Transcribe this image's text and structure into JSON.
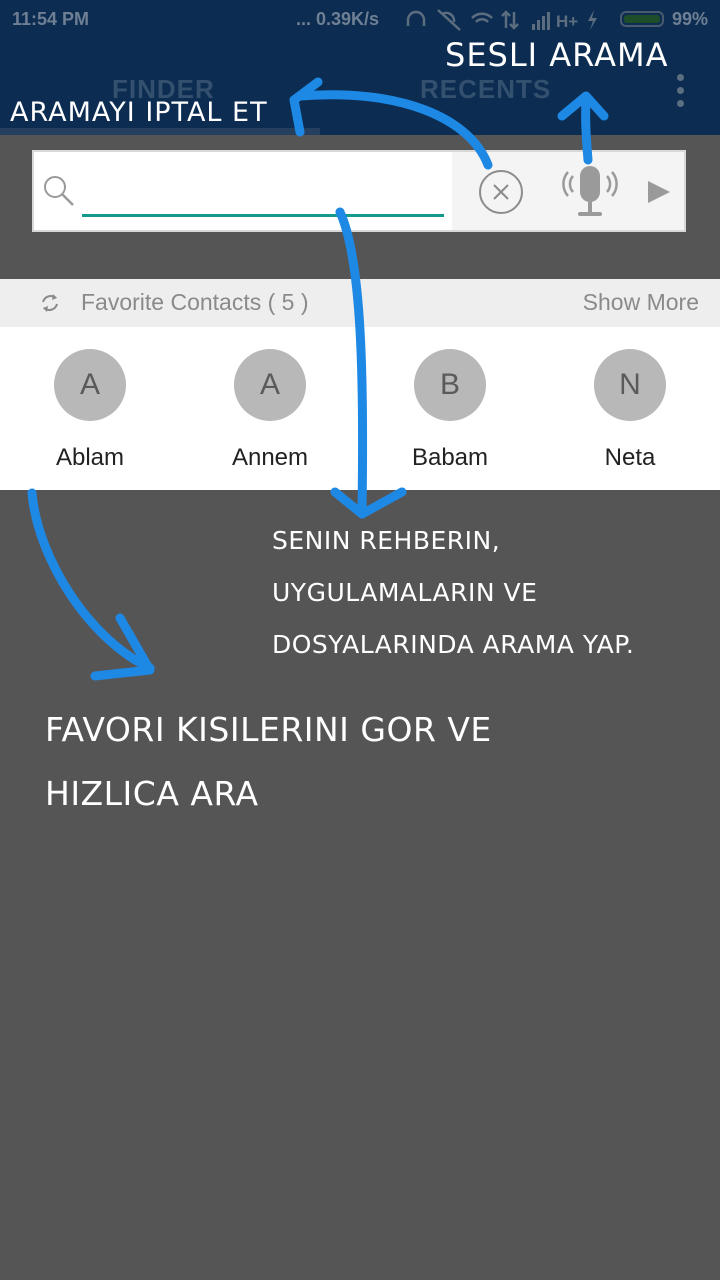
{
  "status_bar": {
    "time": "11:54 PM",
    "network_speed": "... 0.39K/s",
    "battery_percent": "99%",
    "battery_level": 0.99
  },
  "tabs": [
    {
      "label": "FINDER",
      "selected": true
    },
    {
      "label": "RECENTS",
      "selected": false
    }
  ],
  "search": {
    "value": "",
    "placeholder": ""
  },
  "favorites": {
    "title": "Favorite Contacts ( 5 )",
    "show_more": "Show More",
    "contacts": [
      {
        "initial": "A",
        "name": "Ablam"
      },
      {
        "initial": "A",
        "name": "Annem"
      },
      {
        "initial": "B",
        "name": "Babam"
      },
      {
        "initial": "N",
        "name": "Neta"
      }
    ]
  },
  "annotations": {
    "voice_search": "SESLI ARAMA",
    "cancel_search": "ARAMAYI IPTAL ET",
    "search_help": [
      "SENIN REHBERIN,",
      "UYGULAMALARIN VE",
      "DOSYALARINDA ARAMA YAP."
    ],
    "favorites_help": [
      "FAVORI KISILERINI GOR VE",
      "HIZLICA ARA"
    ]
  },
  "colors": {
    "app_bar": "#0c2d51",
    "accent": "#14998d",
    "annotation_arrow": "#1e88e5",
    "background_dim": "#555555"
  },
  "icons": [
    "search-icon",
    "clear-icon",
    "mic-icon",
    "play-icon",
    "refresh-icon",
    "overflow-menu-icon"
  ]
}
